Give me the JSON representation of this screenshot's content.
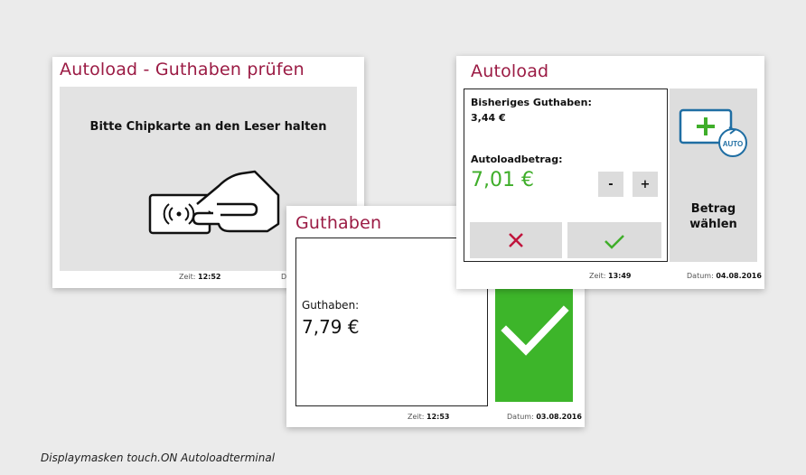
{
  "panel_left": {
    "title": "Autoload - Guthaben prüfen",
    "instruction": "Bitte Chipkarte an den Leser halten",
    "time_label": "Zeit:",
    "time_value": "12:52",
    "date_label": "D"
  },
  "panel_right": {
    "title": "Autoload",
    "previous_balance_label": "Bisheriges Guthaben:",
    "previous_balance_value": "3,44 €",
    "amount_label": "Autoloadbetrag:",
    "amount_value": "7,01 €",
    "minus_label": "-",
    "plus_label": "+",
    "auto_icon_text": "AUTO",
    "select_amount_label_line1": "Betrag",
    "select_amount_label_line2": "wählen",
    "time_label": "Zeit:",
    "time_value": "13:49",
    "date_label": "Datum:",
    "date_value": "04.08.2016",
    "accent_green": "#3fae2a",
    "cancel_red": "#c0143c"
  },
  "panel_middle": {
    "title": "Guthaben",
    "balance_label": "Guthaben:",
    "balance_value": "7,79 €",
    "time_label": "Zeit:",
    "time_value": "12:53",
    "date_label": "Datum:",
    "date_value": "03.08.2016",
    "confirm_color": "#3db52a"
  },
  "caption": "Displaymasken touch.ON Autoloadterminal",
  "icons": [
    "nfc-card-hand-icon",
    "auto-topup-icon",
    "cancel-x-icon",
    "confirm-check-icon",
    "large-check-icon"
  ]
}
